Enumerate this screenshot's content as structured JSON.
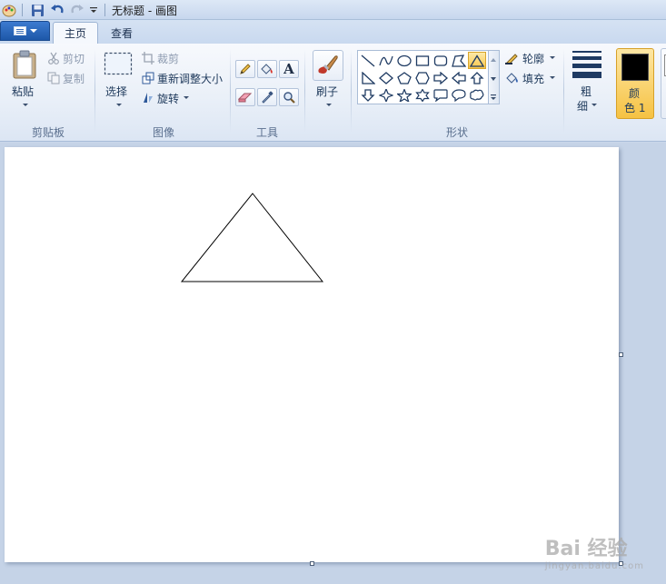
{
  "window": {
    "title": "无标题 - 画图"
  },
  "tabs": [
    {
      "label": "主页",
      "active": true
    },
    {
      "label": "查看",
      "active": false
    }
  ],
  "ribbon": {
    "clipboard": {
      "paste_label": "粘贴",
      "cut_label": "剪切",
      "copy_label": "复制",
      "group_label": "剪贴板"
    },
    "image": {
      "select_label": "选择",
      "crop_label": "裁剪",
      "resize_label": "重新调整大小",
      "rotate_label": "旋转",
      "group_label": "图像"
    },
    "tools": {
      "group_label": "工具",
      "text_glyph": "A"
    },
    "brushes": {
      "label": "刷子"
    },
    "shapes": {
      "outline_label": "轮廓",
      "fill_label": "填充",
      "group_label": "形状"
    },
    "size": {
      "label_line1": "粗",
      "label_line2": "细"
    },
    "color1": {
      "label_line1": "颜",
      "label_line2": "色 1",
      "value": "#000000"
    }
  },
  "watermark": {
    "main": "Bai 经验",
    "sub": "jingyan.baidu.com"
  },
  "colors": {
    "accent": "#f9c74d",
    "file_tab": "#2a66bd"
  }
}
